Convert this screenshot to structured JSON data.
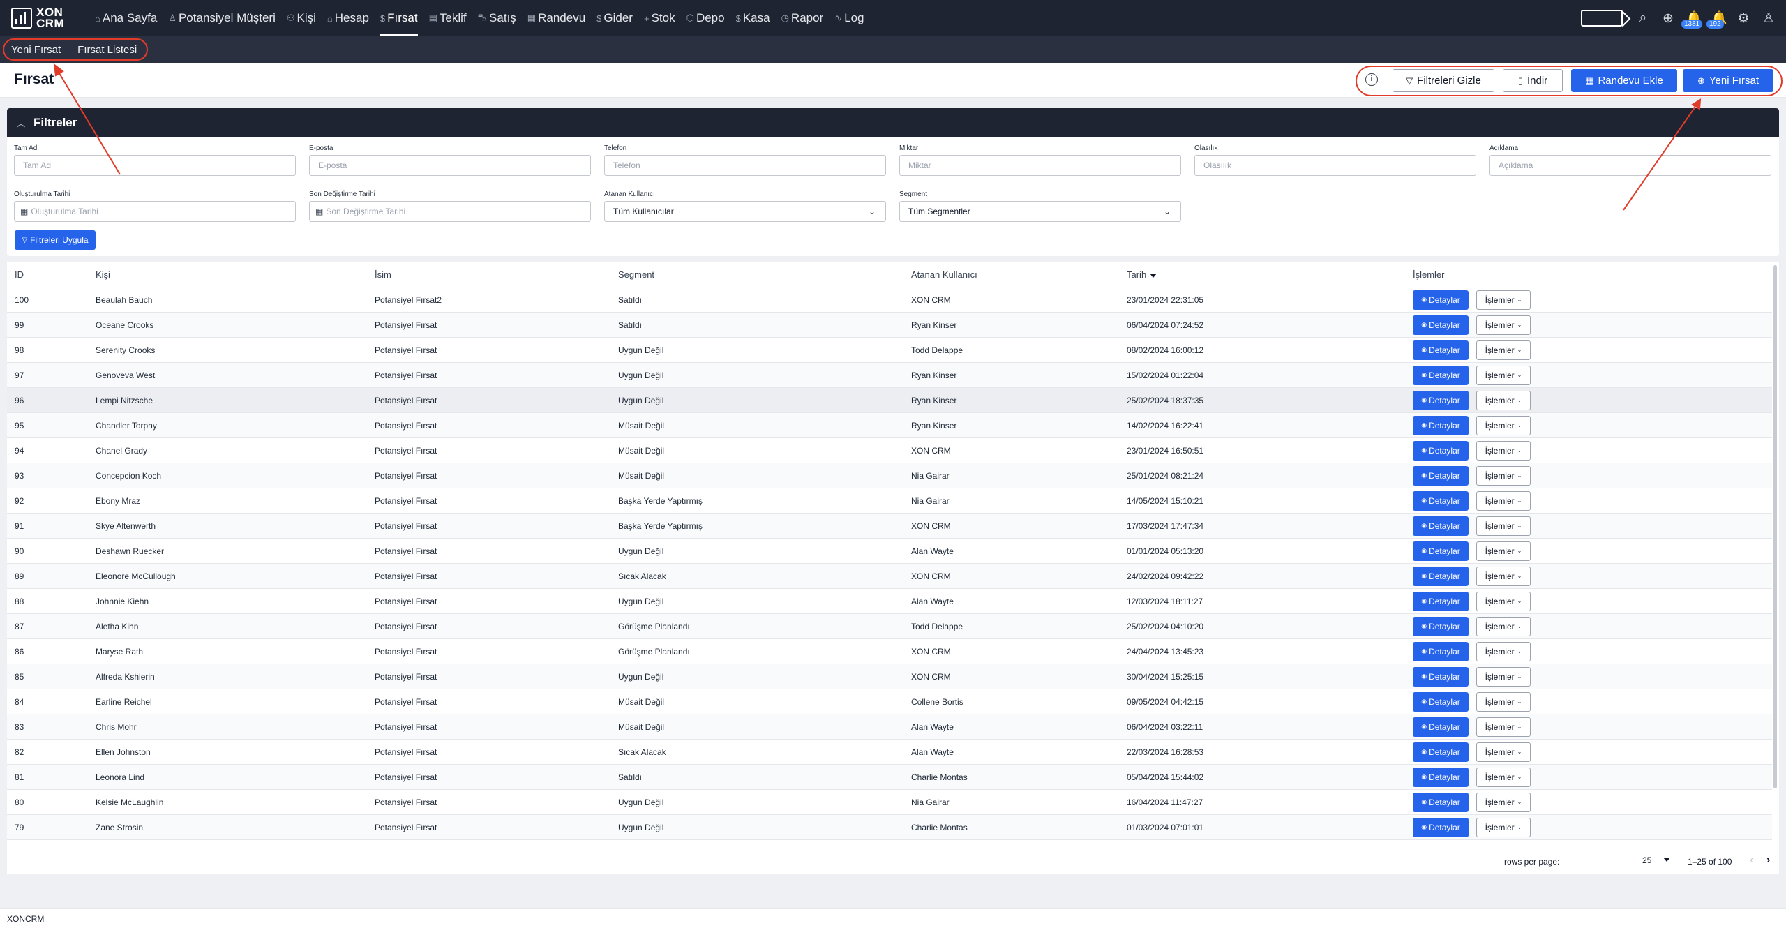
{
  "app": {
    "logo_line1": "XON",
    "logo_line2": "CRM"
  },
  "nav": {
    "items": [
      {
        "label": "Ana Sayfa",
        "icon": "home-icon",
        "glyph": "⌂"
      },
      {
        "label": "Potansiyel Müşteri",
        "icon": "user-icon",
        "glyph": "♙"
      },
      {
        "label": "Kişi",
        "icon": "users-icon",
        "glyph": "⚇"
      },
      {
        "label": "Hesap",
        "icon": "building-icon",
        "glyph": "⌂"
      },
      {
        "label": "Fırsat",
        "icon": "dollar-icon",
        "glyph": "$",
        "active": true
      },
      {
        "label": "Teklif",
        "icon": "document-icon",
        "glyph": "▤"
      },
      {
        "label": "Satış",
        "icon": "cart-icon",
        "glyph": "⛍"
      },
      {
        "label": "Randevu",
        "icon": "calendar-icon",
        "glyph": "▦"
      },
      {
        "label": "Gider",
        "icon": "dollar-icon",
        "glyph": "$"
      },
      {
        "label": "Stok",
        "icon": "plus-icon",
        "glyph": "+"
      },
      {
        "label": "Depo",
        "icon": "box-icon",
        "glyph": "⬡"
      },
      {
        "label": "Kasa",
        "icon": "dollar-icon",
        "glyph": "$"
      },
      {
        "label": "Rapor",
        "icon": "clock-icon",
        "glyph": "◷"
      },
      {
        "label": "Log",
        "icon": "activity-icon",
        "glyph": "∿"
      }
    ],
    "badge_notifications": "1381",
    "badge_alerts": "192"
  },
  "subnav": {
    "new_opportunity": "Yeni Fırsat",
    "opportunity_list": "Fırsat Listesi"
  },
  "header": {
    "title": "Fırsat",
    "hide_filters": "Filtreleri Gizle",
    "download": "İndir",
    "add_appointment": "Randevu Ekle",
    "new_opportunity": "Yeni Fırsat"
  },
  "filters": {
    "title": "Filtreler",
    "fields_row1": [
      {
        "label": "Tam Ad",
        "placeholder": "Tam Ad"
      },
      {
        "label": "E-posta",
        "placeholder": "E-posta"
      },
      {
        "label": "Telefon",
        "placeholder": "Telefon"
      },
      {
        "label": "Miktar",
        "placeholder": "Miktar"
      },
      {
        "label": "Olasılık",
        "placeholder": "Olasılık"
      },
      {
        "label": "Açıklama",
        "placeholder": "Açıklama"
      }
    ],
    "created_label": "Oluşturulma Tarihi",
    "created_placeholder": "Oluşturulma Tarihi",
    "modified_label": "Son Değiştirme Tarihi",
    "modified_placeholder": "Son Değiştirme Tarihi",
    "assigned_label": "Atanan Kullanıcı",
    "assigned_value": "Tüm Kullanıcılar",
    "segment_label": "Segment",
    "segment_value": "Tüm Segmentler",
    "apply": "Filtreleri Uygula"
  },
  "table": {
    "columns": {
      "id": "ID",
      "person": "Kişi",
      "name": "İsim",
      "segment": "Segment",
      "assigned": "Atanan Kullanıcı",
      "date": "Tarih",
      "actions": "İşlemler"
    },
    "details_label": "Detaylar",
    "actions_label": "İşlemler",
    "rows": [
      {
        "id": "100",
        "person": "Beaulah Bauch",
        "name": "Potansiyel Fırsat2",
        "segment": "Satıldı",
        "assigned": "XON CRM",
        "date": "23/01/2024 22:31:05"
      },
      {
        "id": "99",
        "person": "Oceane Crooks",
        "name": "Potansiyel Fırsat",
        "segment": "Satıldı",
        "assigned": "Ryan Kinser",
        "date": "06/04/2024 07:24:52"
      },
      {
        "id": "98",
        "person": "Serenity Crooks",
        "name": "Potansiyel Fırsat",
        "segment": "Uygun Değil",
        "assigned": "Todd Delappe",
        "date": "08/02/2024 16:00:12"
      },
      {
        "id": "97",
        "person": "Genoveva West",
        "name": "Potansiyel Fırsat",
        "segment": "Uygun Değil",
        "assigned": "Ryan Kinser",
        "date": "15/02/2024 01:22:04"
      },
      {
        "id": "96",
        "person": "Lempi Nitzsche",
        "name": "Potansiyel Fırsat",
        "segment": "Uygun Değil",
        "assigned": "Ryan Kinser",
        "date": "25/02/2024 18:37:35"
      },
      {
        "id": "95",
        "person": "Chandler Torphy",
        "name": "Potansiyel Fırsat",
        "segment": "Müsait Değil",
        "assigned": "Ryan Kinser",
        "date": "14/02/2024 16:22:41"
      },
      {
        "id": "94",
        "person": "Chanel Grady",
        "name": "Potansiyel Fırsat",
        "segment": "Müsait Değil",
        "assigned": "XON CRM",
        "date": "23/01/2024 16:50:51"
      },
      {
        "id": "93",
        "person": "Concepcion Koch",
        "name": "Potansiyel Fırsat",
        "segment": "Müsait Değil",
        "assigned": "Nia Gairar",
        "date": "25/01/2024 08:21:24"
      },
      {
        "id": "92",
        "person": "Ebony Mraz",
        "name": "Potansiyel Fırsat",
        "segment": "Başka Yerde Yaptırmış",
        "assigned": "Nia Gairar",
        "date": "14/05/2024 15:10:21"
      },
      {
        "id": "91",
        "person": "Skye Altenwerth",
        "name": "Potansiyel Fırsat",
        "segment": "Başka Yerde Yaptırmış",
        "assigned": "XON CRM",
        "date": "17/03/2024 17:47:34"
      },
      {
        "id": "90",
        "person": "Deshawn Ruecker",
        "name": "Potansiyel Fırsat",
        "segment": "Uygun Değil",
        "assigned": "Alan Wayte",
        "date": "01/01/2024 05:13:20"
      },
      {
        "id": "89",
        "person": "Eleonore McCullough",
        "name": "Potansiyel Fırsat",
        "segment": "Sıcak Alacak",
        "assigned": "XON CRM",
        "date": "24/02/2024 09:42:22"
      },
      {
        "id": "88",
        "person": "Johnnie Kiehn",
        "name": "Potansiyel Fırsat",
        "segment": "Uygun Değil",
        "assigned": "Alan Wayte",
        "date": "12/03/2024 18:11:27"
      },
      {
        "id": "87",
        "person": "Aletha Kihn",
        "name": "Potansiyel Fırsat",
        "segment": "Görüşme Planlandı",
        "assigned": "Todd Delappe",
        "date": "25/02/2024 04:10:20"
      },
      {
        "id": "86",
        "person": "Maryse Rath",
        "name": "Potansiyel Fırsat",
        "segment": "Görüşme Planlandı",
        "assigned": "XON CRM",
        "date": "24/04/2024 13:45:23"
      },
      {
        "id": "85",
        "person": "Alfreda Kshlerin",
        "name": "Potansiyel Fırsat",
        "segment": "Uygun Değil",
        "assigned": "XON CRM",
        "date": "30/04/2024 15:25:15"
      },
      {
        "id": "84",
        "person": "Earline Reichel",
        "name": "Potansiyel Fırsat",
        "segment": "Müsait Değil",
        "assigned": "Collene Bortis",
        "date": "09/05/2024 04:42:15"
      },
      {
        "id": "83",
        "person": "Chris Mohr",
        "name": "Potansiyel Fırsat",
        "segment": "Müsait Değil",
        "assigned": "Alan Wayte",
        "date": "06/04/2024 03:22:11"
      },
      {
        "id": "82",
        "person": "Ellen Johnston",
        "name": "Potansiyel Fırsat",
        "segment": "Sıcak Alacak",
        "assigned": "Alan Wayte",
        "date": "22/03/2024 16:28:53"
      },
      {
        "id": "81",
        "person": "Leonora Lind",
        "name": "Potansiyel Fırsat",
        "segment": "Satıldı",
        "assigned": "Charlie Montas",
        "date": "05/04/2024 15:44:02"
      },
      {
        "id": "80",
        "person": "Kelsie McLaughlin",
        "name": "Potansiyel Fırsat",
        "segment": "Uygun Değil",
        "assigned": "Nia Gairar",
        "date": "16/04/2024 11:47:27"
      },
      {
        "id": "79",
        "person": "Zane Strosin",
        "name": "Potansiyel Fırsat",
        "segment": "Uygun Değil",
        "assigned": "Charlie Montas",
        "date": "01/03/2024 07:01:01"
      }
    ]
  },
  "pagination": {
    "rows_per_page_label": "rows per page:",
    "rows_per_page": "25",
    "range": "1–25 of 100"
  },
  "footer": {
    "text": "XONCRM"
  },
  "colors": {
    "nav_bg": "#1e2432",
    "primary": "#2563eb",
    "annotation": "#e23b2a"
  }
}
